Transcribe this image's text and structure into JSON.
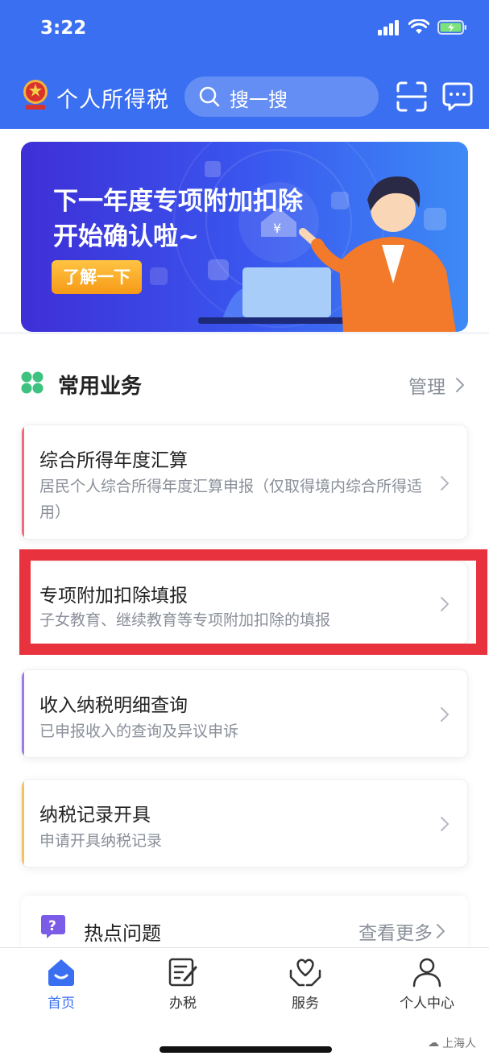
{
  "status_bar": {
    "time": "3:22"
  },
  "header": {
    "app_title": "个人所得税",
    "search_placeholder": "搜一搜",
    "icons": [
      "app-logo",
      "search-icon",
      "scan-icon",
      "message-icon"
    ]
  },
  "banner": {
    "title_line1": "下一年度专项附加扣除",
    "title_line2": "开始确认啦~",
    "button_label": "了解一下"
  },
  "section": {
    "title": "常用业务",
    "manage_label": "管理"
  },
  "cards": [
    {
      "title": "综合所得年度汇算",
      "desc": "居民个人综合所得年度汇算申报（仅取得境内综合所得适用）",
      "accent": "#f06b7a"
    },
    {
      "title": "专项附加扣除填报",
      "desc": "子女教育、继续教育等专项附加扣除的填报",
      "accent": "#3a6ff2"
    },
    {
      "title": "收入纳税明细查询",
      "desc": "已申报收入的查询及异议申诉",
      "accent": "#9b7be8"
    },
    {
      "title": "纳税记录开具",
      "desc": "申请开具纳税记录",
      "accent": "#f6c163"
    }
  ],
  "hot": {
    "title": "热点问题",
    "more_label": "查看更多"
  },
  "tabbar": {
    "tabs": [
      {
        "label": "首页",
        "icon": "home-icon"
      },
      {
        "label": "办税",
        "icon": "edit-document-icon"
      },
      {
        "label": "服务",
        "icon": "heart-hands-icon"
      },
      {
        "label": "个人中心",
        "icon": "person-icon"
      }
    ],
    "watermark": "上海人"
  },
  "colors": {
    "brand": "#3a6ff2",
    "highlight": "#e8323e",
    "button": "#f69a17"
  }
}
